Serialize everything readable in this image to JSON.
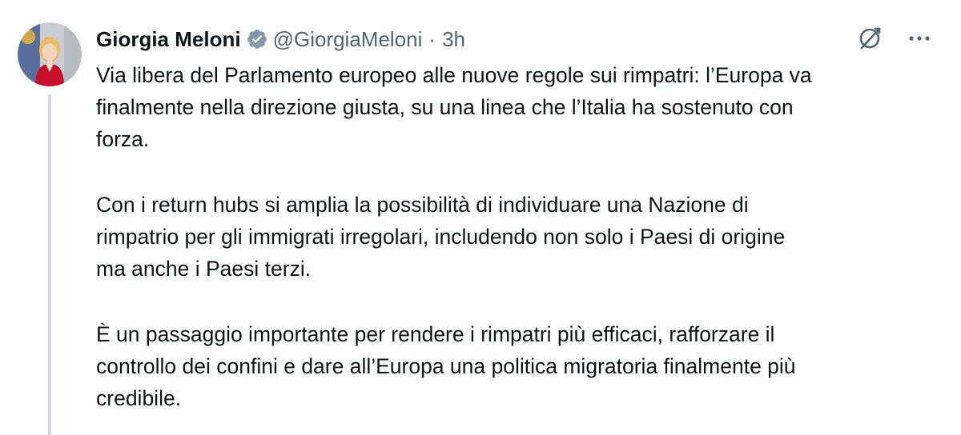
{
  "tweet": {
    "author_name": "Giorgia Meloni",
    "handle": "@GiorgiaMeloni",
    "separator": "·",
    "time": "3h",
    "verified_icon": "verified-badge-icon",
    "paragraphs": [
      "Via libera del Parlamento europeo alle nuove regole sui rimpatri: l’Europa va\nfinalmente nella direzione giusta, su una linea che l’Italia ha sostenuto con\nforza.",
      "Con i return hubs si amplia la possibilità di individuare una Nazione di\nrimpatrio per gli immigrati irregolari, includendo non solo i Paesi di origine\nma anche i Paesi terzi.",
      "È un passaggio importante per rendere i rimpatri più efficaci, rafforzare il\ncontrollo dei confini e dare all’Europa una politica migratoria finalmente più\ncredibile."
    ]
  },
  "colors": {
    "text": "#0f1419",
    "secondary": "#536471",
    "thread_line": "#cfd9de",
    "verified": "#829aab"
  }
}
